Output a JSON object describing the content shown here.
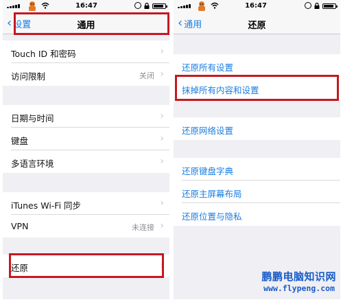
{
  "status_bar": {
    "time": "16:47"
  },
  "left_screen": {
    "nav": {
      "back_label": "设置",
      "title": "通用"
    },
    "rows": [
      {
        "label": "Touch ID 和密码",
        "value": ""
      },
      {
        "label": "访问限制",
        "value": "关闭"
      },
      {
        "label": "日期与时间",
        "value": ""
      },
      {
        "label": "键盘",
        "value": ""
      },
      {
        "label": "多语言环境",
        "value": ""
      },
      {
        "label": "iTunes Wi-Fi 同步",
        "value": ""
      },
      {
        "label": "VPN",
        "value": "未连接"
      },
      {
        "label": "还原",
        "value": ""
      }
    ]
  },
  "right_screen": {
    "nav": {
      "back_label": "通用",
      "title": "还原"
    },
    "rows": [
      {
        "label": "还原所有设置"
      },
      {
        "label": "抹掉所有内容和设置"
      },
      {
        "label": "还原网络设置"
      },
      {
        "label": "还原键盘字典"
      },
      {
        "label": "还原主屏幕布局"
      },
      {
        "label": "还原位置与隐私"
      }
    ]
  },
  "watermark": {
    "title": "鹏鹏电脑知识网",
    "url": "www.flypeng.com"
  },
  "colors": {
    "accent": "#1a7ee0",
    "highlight": "#c41820",
    "background": "#efeff4"
  }
}
